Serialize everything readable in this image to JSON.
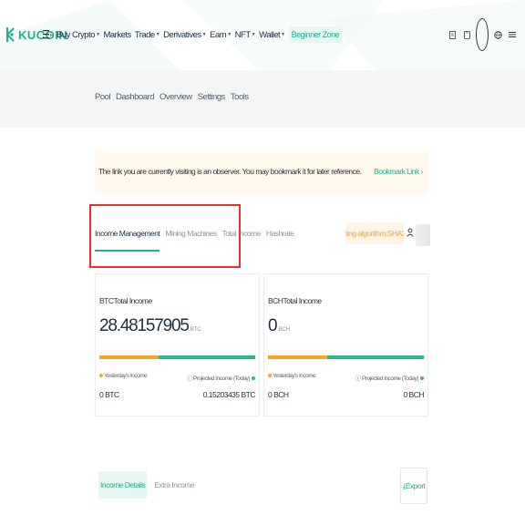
{
  "brand": {
    "name": "KUCOIN",
    "accent": "#23af91",
    "warning": "#f5a623",
    "highlight": "#e8312f"
  },
  "nav": {
    "items": [
      {
        "label": "Buy Crypto",
        "dropdown": true
      },
      {
        "label": "Markets",
        "dropdown": false
      },
      {
        "label": "Trade",
        "dropdown": true
      },
      {
        "label": "Derivatives",
        "dropdown": true
      },
      {
        "label": "Earn",
        "dropdown": true
      },
      {
        "label": "NFT",
        "dropdown": true
      },
      {
        "label": "Wallet",
        "dropdown": true
      }
    ],
    "beginner_label": "Beginner Zone",
    "right_icons": [
      "document-icon",
      "download-icon",
      "avatar",
      "globe-icon",
      "menu-icon"
    ]
  },
  "subnav": {
    "items": [
      "Pool",
      "Dashboard",
      "Overview",
      "Settings",
      "Tools"
    ]
  },
  "banner": {
    "text": "The link you are currently visiting is an observer. You may bookmark it for later reference.",
    "link": "Bookmark Link"
  },
  "tabs": {
    "items": [
      "Income Management",
      "Mining Machines",
      "Total Income",
      "Hashrate"
    ],
    "active_index": 0
  },
  "mining_badge": "Mining algorithm:SHA256",
  "cards": [
    {
      "title": "BTCTotal Income",
      "amount": "28.48157905",
      "unit": "BTC",
      "yesterday_label": "Yesterday's Income",
      "projected_label": "Projected Income (Today)",
      "yesterday_value": "0 BTC",
      "projected_value": "0.15203435 BTC",
      "bar_fraction": 0.38
    },
    {
      "title": "BCHTotal Income",
      "amount": "0",
      "unit": "BCH",
      "yesterday_label": "Yesterday's Income",
      "projected_label": "Projected Income (Today)",
      "yesterday_value": "0 BCH",
      "projected_value": "0 BCH",
      "bar_fraction": 0.38
    }
  ],
  "bottom_tabs": {
    "items": [
      "Income Details",
      "Extra Income"
    ],
    "active_index": 0
  },
  "export_label": "Export"
}
